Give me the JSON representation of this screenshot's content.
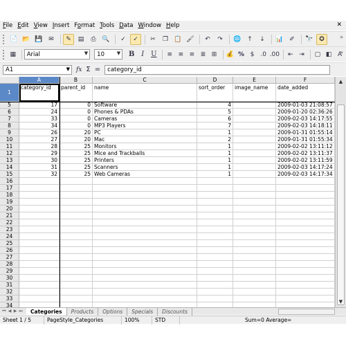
{
  "menu": [
    "File",
    "Edit",
    "View",
    "Insert",
    "Format",
    "Tools",
    "Data",
    "Window",
    "Help"
  ],
  "menu_accel": [
    "F",
    "E",
    "V",
    "I",
    "o",
    "T",
    "D",
    "W",
    "H"
  ],
  "menu_close": "✕",
  "format_toolbar": {
    "font_name": "Arial",
    "font_size": "10",
    "bold": "B",
    "italic": "I",
    "underline": "U"
  },
  "formula_bar": {
    "cell_ref": "A1",
    "fx": "fx",
    "sigma": "Σ",
    "equals": "=",
    "content": "category_id"
  },
  "sheet": {
    "columns": [
      "A",
      "B",
      "C",
      "D",
      "E",
      "F"
    ],
    "headers": [
      "category_id",
      "parent_id",
      "name",
      "sort_order",
      "image_name",
      "date_added"
    ],
    "header_row_number": "1",
    "rows": [
      {
        "n": "5",
        "cells": [
          "17",
          "0",
          "Software",
          "4",
          "",
          "2009-01-03 21:08:57"
        ]
      },
      {
        "n": "6",
        "cells": [
          "24",
          "0",
          "Phones & PDAs",
          "5",
          "",
          "2009-01-20 02:36:26"
        ]
      },
      {
        "n": "7",
        "cells": [
          "33",
          "0",
          "Cameras",
          "6",
          "",
          "2009-02-03 14:17:55"
        ]
      },
      {
        "n": "8",
        "cells": [
          "34",
          "0",
          "MP3 Players",
          "7",
          "",
          "2009-02-03 14:18:11"
        ]
      },
      {
        "n": "9",
        "cells": [
          "26",
          "20",
          "PC",
          "1",
          "",
          "2009-01-31 01:55:14"
        ]
      },
      {
        "n": "10",
        "cells": [
          "27",
          "20",
          "Mac",
          "2",
          "",
          "2009-01-31 01:55:34"
        ]
      },
      {
        "n": "11",
        "cells": [
          "28",
          "25",
          "Monitors",
          "1",
          "",
          "2009-02-02 13:11:12"
        ]
      },
      {
        "n": "12",
        "cells": [
          "29",
          "25",
          "Mice and Trackballs",
          "1",
          "",
          "2009-02-02 13:11:37"
        ]
      },
      {
        "n": "13",
        "cells": [
          "30",
          "25",
          "Printers",
          "1",
          "",
          "2009-02-02 13:11:59"
        ]
      },
      {
        "n": "14",
        "cells": [
          "31",
          "25",
          "Scanners",
          "1",
          "",
          "2009-02-03 14:17:24"
        ]
      },
      {
        "n": "15",
        "cells": [
          "32",
          "25",
          "Web Cameras",
          "1",
          "",
          "2009-02-03 14:17:34"
        ]
      },
      {
        "n": "16",
        "cells": [
          "",
          "",
          "",
          "",
          "",
          ""
        ]
      },
      {
        "n": "17",
        "cells": [
          "",
          "",
          "",
          "",
          "",
          ""
        ]
      },
      {
        "n": "18",
        "cells": [
          "",
          "",
          "",
          "",
          "",
          ""
        ]
      },
      {
        "n": "19",
        "cells": [
          "",
          "",
          "",
          "",
          "",
          ""
        ]
      },
      {
        "n": "20",
        "cells": [
          "",
          "",
          "",
          "",
          "",
          ""
        ]
      },
      {
        "n": "21",
        "cells": [
          "",
          "",
          "",
          "",
          "",
          ""
        ]
      },
      {
        "n": "22",
        "cells": [
          "",
          "",
          "",
          "",
          "",
          ""
        ]
      },
      {
        "n": "23",
        "cells": [
          "",
          "",
          "",
          "",
          "",
          ""
        ]
      },
      {
        "n": "24",
        "cells": [
          "",
          "",
          "",
          "",
          "",
          ""
        ]
      },
      {
        "n": "25",
        "cells": [
          "",
          "",
          "",
          "",
          "",
          ""
        ]
      },
      {
        "n": "26",
        "cells": [
          "",
          "",
          "",
          "",
          "",
          ""
        ]
      },
      {
        "n": "27",
        "cells": [
          "",
          "",
          "",
          "",
          "",
          ""
        ]
      },
      {
        "n": "28",
        "cells": [
          "",
          "",
          "",
          "",
          "",
          ""
        ]
      },
      {
        "n": "29",
        "cells": [
          "",
          "",
          "",
          "",
          "",
          ""
        ]
      },
      {
        "n": "30",
        "cells": [
          "",
          "",
          "",
          "",
          "",
          ""
        ]
      },
      {
        "n": "31",
        "cells": [
          "",
          "",
          "",
          "",
          "",
          ""
        ]
      },
      {
        "n": "32",
        "cells": [
          "",
          "",
          "",
          "",
          "",
          ""
        ]
      },
      {
        "n": "33",
        "cells": [
          "",
          "",
          "",
          "",
          "",
          ""
        ]
      },
      {
        "n": "34",
        "cells": [
          "",
          "",
          "",
          "",
          "",
          ""
        ]
      }
    ]
  },
  "sheet_tabs": [
    "Categories",
    "Products",
    "Options",
    "Specials",
    "Discounts"
  ],
  "active_tab": "Categories",
  "status": {
    "sheet": "Sheet 1 / 5",
    "page_style": "PageStyle_Categories",
    "zoom": "100%",
    "mode": "STD",
    "summary": "Sum=0 Average="
  },
  "colors": {
    "selection": "#5b88c6",
    "toolbar_bg": "#efefef",
    "header_bg": "#e8e8e8"
  }
}
